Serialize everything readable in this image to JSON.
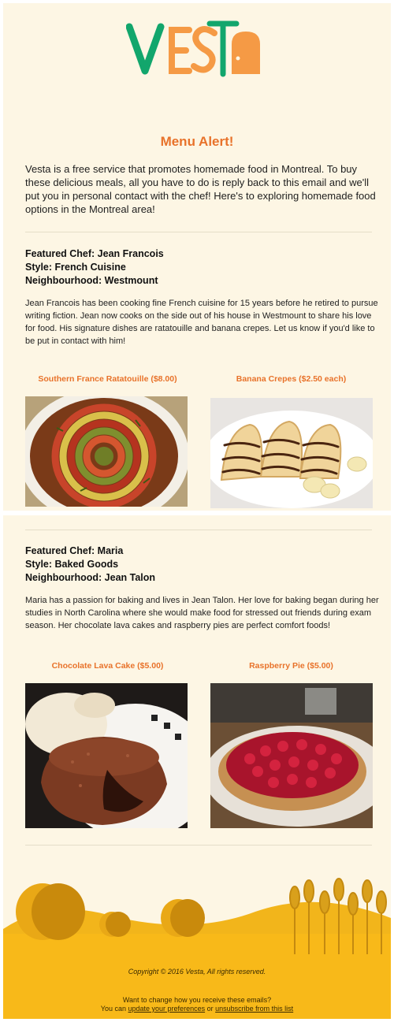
{
  "brand": {
    "name": "Vesta",
    "primary": "#12a66c",
    "accent": "#f59a45"
  },
  "alert": {
    "title": "Menu Alert!",
    "intro": "Vesta is a free service that promotes homemade food in Montreal. To buy these delicious meals, all you have to do is reply back to this email and we'll put you in personal contact with the chef! Here's to exploring homemade food options in the Montreal area!"
  },
  "chefs": [
    {
      "featured": "Featured Chef: Jean Francois",
      "style": "Style: French Cuisine",
      "neighbourhood": "Neighbourhood: Westmount",
      "description": "Jean Francois has been cooking fine French cuisine for 15 years before he retired to pursue writing fiction. Jean now cooks on the side out of his house in Westmount to share his love for food. His signature dishes are ratatouille and banana crepes. Let us know if you'd like to be put in contact with him!",
      "dishes": [
        {
          "title": "Southern France Ratatouille ($8.00)",
          "photo": "ratatouille"
        },
        {
          "title": "Banana Crepes ($2.50 each)",
          "photo": "banana-crepes"
        }
      ]
    },
    {
      "featured": "Featured Chef: Maria",
      "style": "Style: Baked Goods",
      "neighbourhood": "Neighbourhood: Jean Talon",
      "description": "Maria has a passion for baking and lives in Jean Talon. Her love for baking began during her studies in North Carolina where she would make food for stressed out friends during exam season. Her chocolate lava cakes and raspberry pies are perfect comfort foods!",
      "dishes": [
        {
          "title": "Chocolate Lava Cake ($5.00)",
          "photo": "chocolate-lava-cake"
        },
        {
          "title": "Raspberry Pie ($5.00)",
          "photo": "raspberry-pie"
        }
      ]
    }
  ],
  "footer": {
    "copyright": "Copyright © 2016 Vesta, All rights reserved.",
    "change_text": "Want to change how you receive these emails?",
    "you_can": "You can",
    "update_link": "update your preferences",
    "or": "or",
    "unsubscribe_link": "unsubscribe from this list"
  }
}
